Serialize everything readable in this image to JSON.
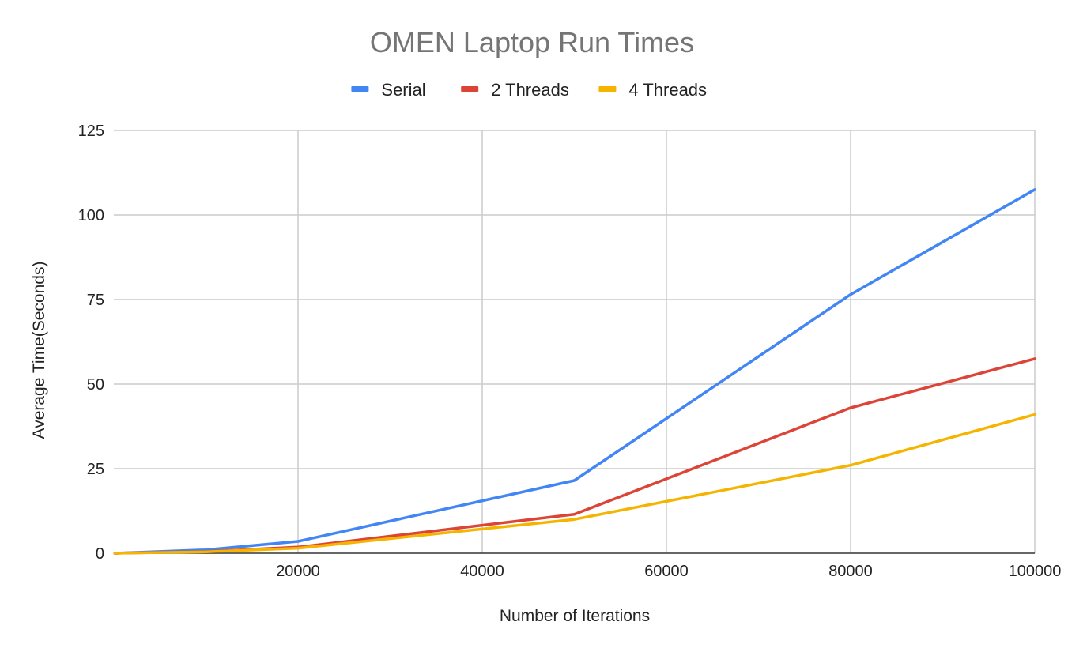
{
  "chart_data": {
    "type": "line",
    "title": "OMEN Laptop Run Times",
    "xlabel": "Number of Iterations",
    "ylabel": "Average Time(Seconds)",
    "xlim": [
      0,
      100000
    ],
    "ylim": [
      0,
      125
    ],
    "x_ticks": [
      20000,
      40000,
      60000,
      80000,
      100000
    ],
    "x_tick_labels": [
      "20000",
      "40000",
      "60000",
      "80000",
      "100000"
    ],
    "y_ticks": [
      0,
      25,
      50,
      75,
      100,
      125
    ],
    "y_tick_labels": [
      "0",
      "25",
      "50",
      "75",
      "100",
      "125"
    ],
    "x_grid": true,
    "y_grid": true,
    "legend_position": "top",
    "x": [
      100,
      1000,
      10000,
      20000,
      50000,
      80000,
      100000
    ],
    "series": [
      {
        "name": "Serial",
        "color": "#4285F4",
        "values": [
          0.01,
          0.1,
          1.0,
          3.5,
          21.5,
          76.5,
          107.5
        ]
      },
      {
        "name": "2 Threads",
        "color": "#DB4437",
        "values": [
          0.01,
          0.05,
          0.5,
          1.8,
          11.5,
          43.0,
          57.5
        ]
      },
      {
        "name": "4 Threads",
        "color": "#F4B400",
        "values": [
          0.01,
          0.05,
          0.4,
          1.5,
          10.0,
          26.0,
          41.0
        ]
      }
    ]
  }
}
